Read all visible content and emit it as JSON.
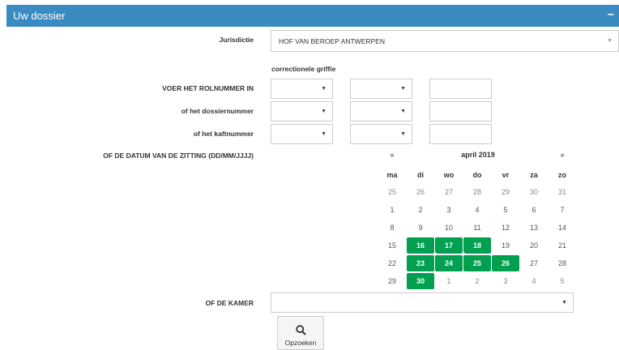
{
  "header": {
    "title": "Uw dossier",
    "collapse_label": "–"
  },
  "form": {
    "jurisdiction_label": "Jurisdictie",
    "jurisdiction_value": "HOF VAN BEROEP ANTWERPEN",
    "registry_label": "correctionele griffie",
    "rolnummer_label": "VOER HET ROLNUMMER IN",
    "dossiernummer_label": "of het dossiernummer",
    "kaftnummer_label": "of het kaftnummer",
    "date_label": "OF DE DATUM VAN DE ZITTING (DD/MM/JJJJ)",
    "kamer_label": "OF DE KAMER",
    "search_label": "Opzoeken"
  },
  "calendar": {
    "prev": "«",
    "next": "»",
    "month": "april 2019",
    "weekdays": [
      "ma",
      "di",
      "wo",
      "do",
      "vr",
      "za",
      "zo"
    ],
    "weeks": [
      [
        "25",
        "26",
        "27",
        "28",
        "29",
        "30",
        "31"
      ],
      [
        "1",
        "2",
        "3",
        "4",
        "5",
        "6",
        "7"
      ],
      [
        "8",
        "9",
        "10",
        "11",
        "12",
        "13",
        "14"
      ],
      [
        "15",
        "16",
        "17",
        "18",
        "19",
        "20",
        "21"
      ],
      [
        "22",
        "23",
        "24",
        "25",
        "26",
        "27",
        "28"
      ],
      [
        "29",
        "30",
        "1",
        "2",
        "3",
        "4",
        "5"
      ]
    ],
    "highlighted_days": [
      "16",
      "17",
      "18",
      "23",
      "24",
      "25",
      "26",
      "30"
    ],
    "highlight_color": "#00a050"
  },
  "colors": {
    "header_bg": "#3a8bc2"
  }
}
